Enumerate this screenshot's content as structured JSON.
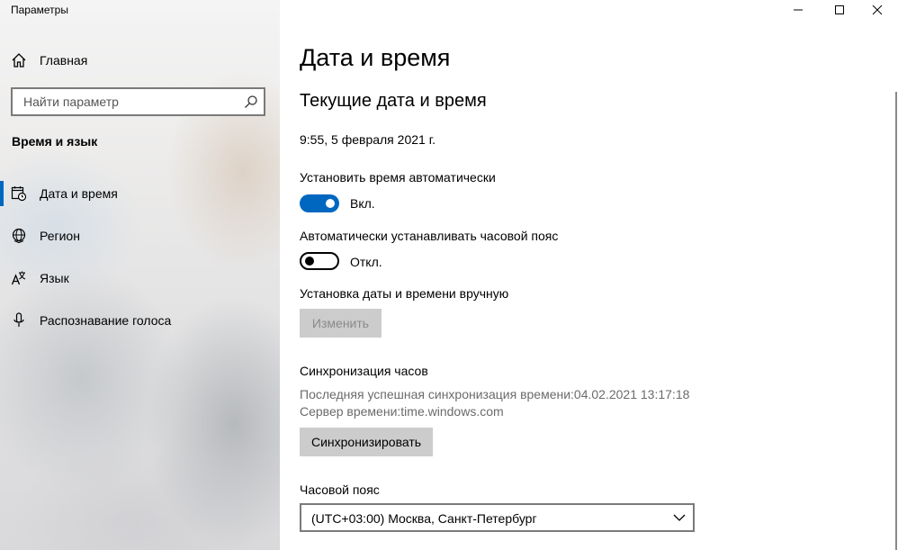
{
  "window": {
    "title": "Параметры",
    "controls": [
      "minimize-icon",
      "maximize-icon",
      "close-icon"
    ]
  },
  "sidebar": {
    "home_label": "Главная",
    "search_placeholder": "Найти параметр",
    "section_title": "Время и язык",
    "items": [
      {
        "label": "Дата и время",
        "icon": "calendar-clock-icon",
        "active": true
      },
      {
        "label": "Регион",
        "icon": "globe-icon",
        "active": false
      },
      {
        "label": "Язык",
        "icon": "language-icon",
        "active": false
      },
      {
        "label": "Распознавание голоса",
        "icon": "microphone-icon",
        "active": false
      }
    ]
  },
  "main": {
    "title": "Дата и время",
    "subtitle": "Текущие дата и время",
    "current_datetime": "9:55, 5 февраля 2021 г.",
    "auto_time": {
      "label": "Установить время автоматически",
      "state": "Вкл.",
      "on": true
    },
    "auto_timezone": {
      "label": "Автоматически устанавливать часовой пояс",
      "state": "Откл.",
      "on": false
    },
    "manual": {
      "label": "Установка даты и времени вручную",
      "button": "Изменить"
    },
    "sync": {
      "title": "Синхронизация часов",
      "last_sync": "Последняя успешная синхронизация времени:04.02.2021 13:17:18",
      "server": "Сервер времени:time.windows.com",
      "button": "Синхронизировать"
    },
    "timezone": {
      "label": "Часовой пояс",
      "value": "(UTC+03:00) Москва, Санкт-Петербург"
    }
  },
  "colors": {
    "accent": "#0067c0",
    "button_bg": "#cccccc"
  }
}
